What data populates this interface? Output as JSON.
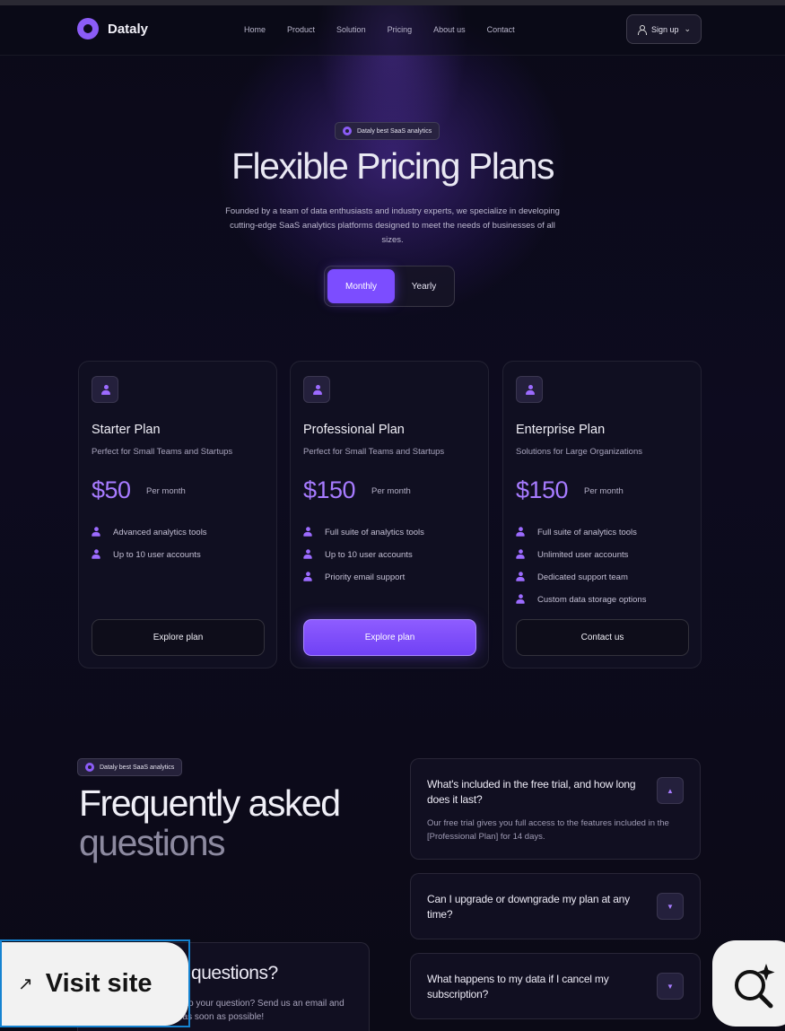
{
  "brand": {
    "name": "Dataly",
    "accent": "#8b5cf6"
  },
  "nav": {
    "links": [
      "Home",
      "Product",
      "Solution",
      "Pricing",
      "About us",
      "Contact"
    ],
    "signup_label": "Sign up"
  },
  "hero": {
    "badge": "Dataly best SaaS analytics",
    "title": "Flexible Pricing Plans",
    "description": "Founded by a team of data enthusiasts and industry experts, we specialize in developing cutting-edge SaaS analytics platforms designed to meet the needs of businesses of all sizes.",
    "billing_toggle": {
      "monthly": "Monthly",
      "yearly": "Yearly",
      "selected": "Monthly"
    }
  },
  "plans": [
    {
      "name": "Starter Plan",
      "subtitle": "Perfect for Small Teams and Startups",
      "price": "$50",
      "period": "Per month",
      "features": [
        "Advanced analytics tools",
        "Up to 10 user accounts"
      ],
      "cta": "Explore plan"
    },
    {
      "name": "Professional Plan",
      "subtitle": "Perfect for Small Teams and Startups",
      "price": "$150",
      "period": "Per month",
      "features": [
        "Full suite of analytics tools",
        "Up to 10 user accounts",
        "Priority email support"
      ],
      "cta": "Explore plan"
    },
    {
      "name": "Enterprise Plan",
      "subtitle": "Solutions for Large Organizations",
      "price": "$150",
      "period": "Per month",
      "features": [
        "Full suite of analytics tools",
        "Unlimited user accounts",
        "Dedicated support team",
        "Custom data storage options"
      ],
      "cta": "Contact us"
    }
  ],
  "faq": {
    "badge": "Dataly best SaaS analytics",
    "title_line1": "Frequently asked",
    "title_line2": "questions",
    "items": [
      {
        "question": "What's included in the free trial, and how long does it last?",
        "answer": "Our free trial gives you full access to the features included in the [Professional Plan] for 14 days.",
        "expanded": true
      },
      {
        "question": "Can I upgrade or downgrade my plan at any time?",
        "expanded": false
      },
      {
        "question": "What happens to my data if I cancel my subscription?",
        "expanded": false
      }
    ],
    "contact": {
      "title": "Still have a questions?",
      "description": "Can't find the answer to your question? Send us an email and we'll get back to you as soon as possible!"
    }
  },
  "overlay": {
    "visit_site_label": "Visit site",
    "visit_icon": "arrow-up-right-icon",
    "lens_icon": "visual-search-icon"
  }
}
